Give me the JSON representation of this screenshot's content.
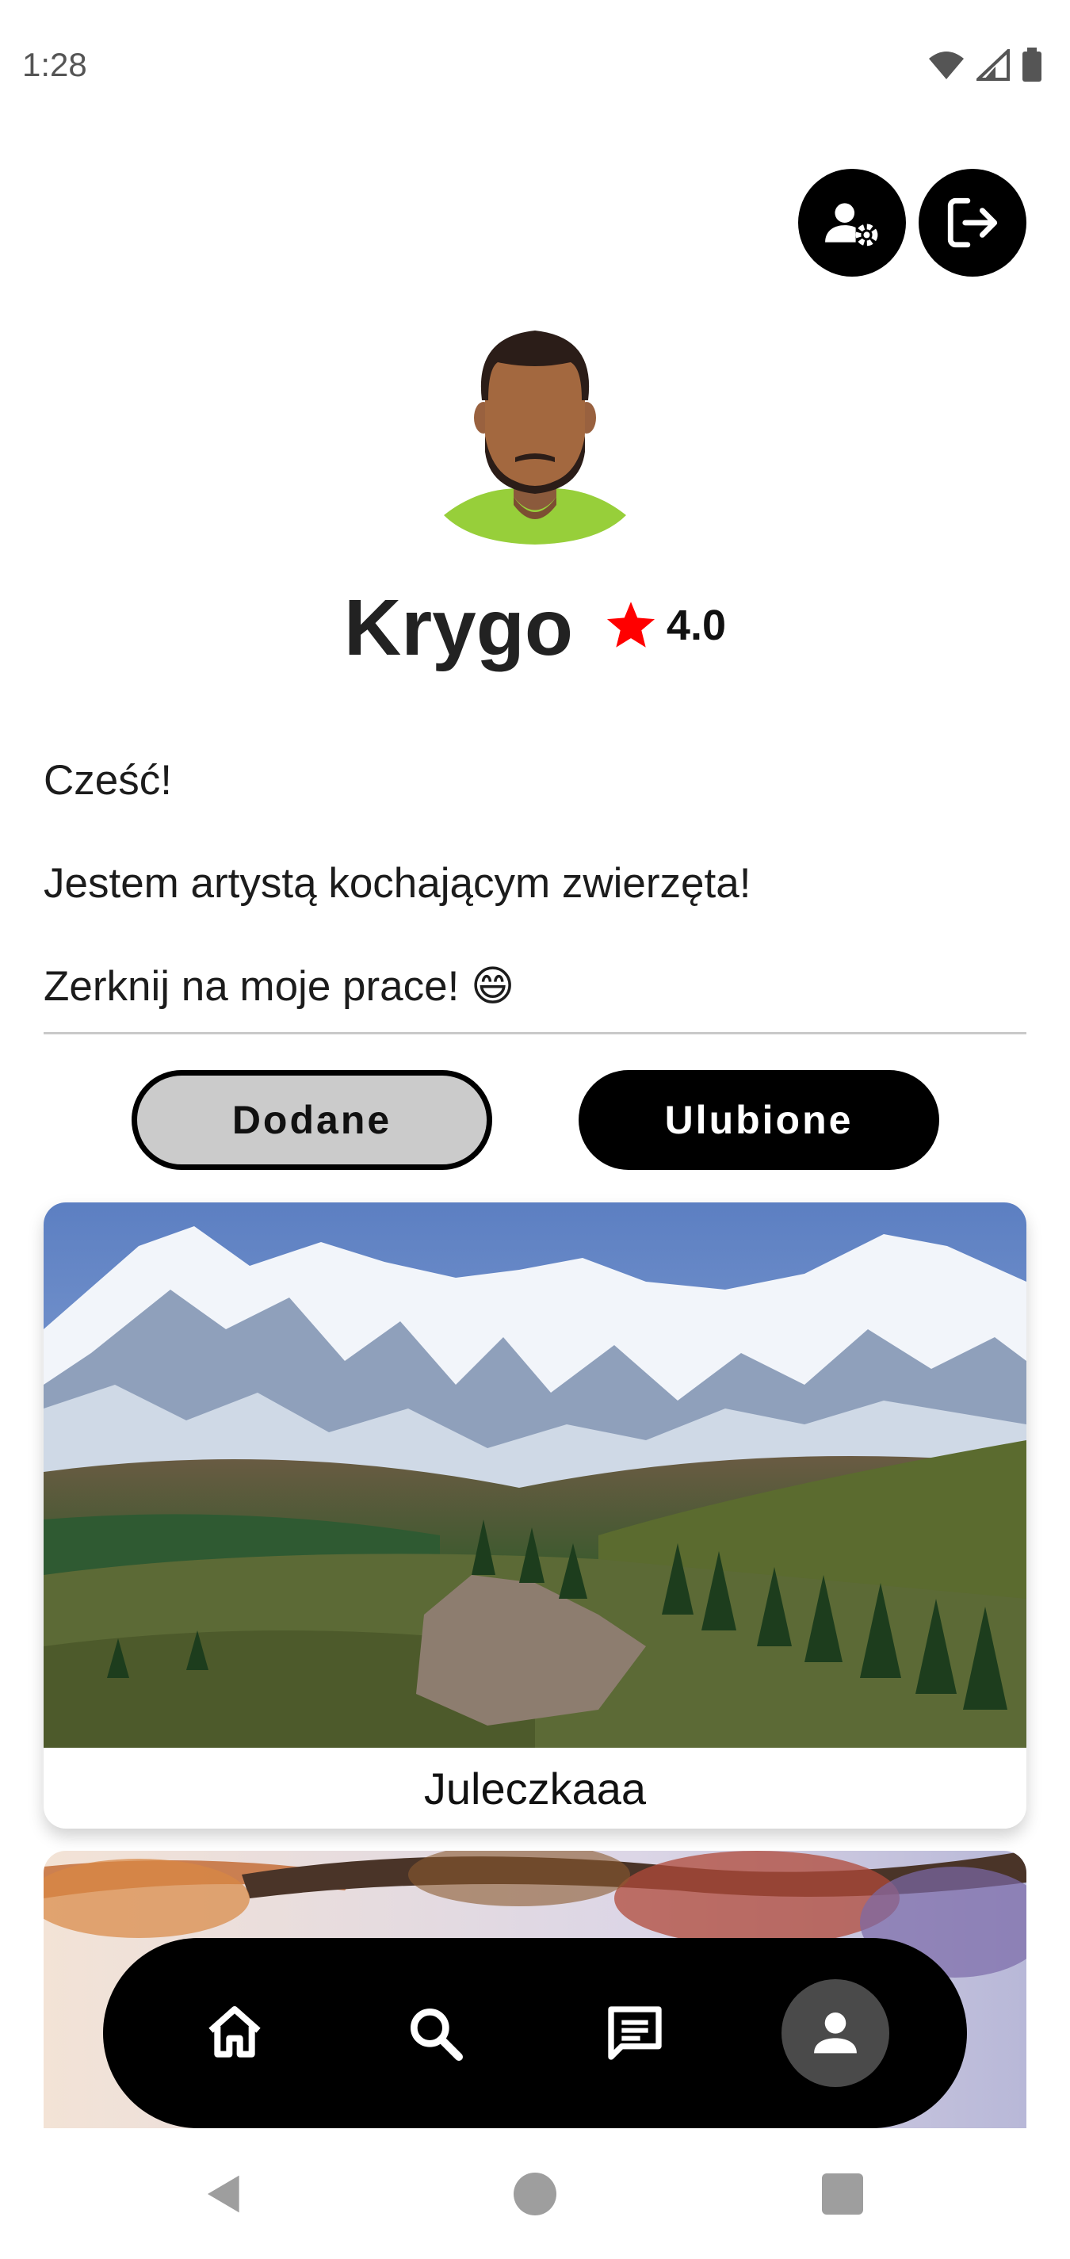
{
  "status_bar": {
    "time": "1:28"
  },
  "profile": {
    "name": "Krygo",
    "rating": "4.0",
    "bio": [
      "Cześć!",
      "Jestem artystą kochającym zwierzęta!",
      "Zerknij na moje prace! 😄"
    ]
  },
  "tabs": {
    "added_label": "Dodane",
    "favorites_label": "Ulubione"
  },
  "cards": [
    {
      "title": "Juleczkaaa"
    }
  ],
  "colors": {
    "accent": "#000000",
    "rating_star": "#ff0000",
    "avatar_shirt": "#97cf3a",
    "selected_tab": "#cbcbcb"
  }
}
